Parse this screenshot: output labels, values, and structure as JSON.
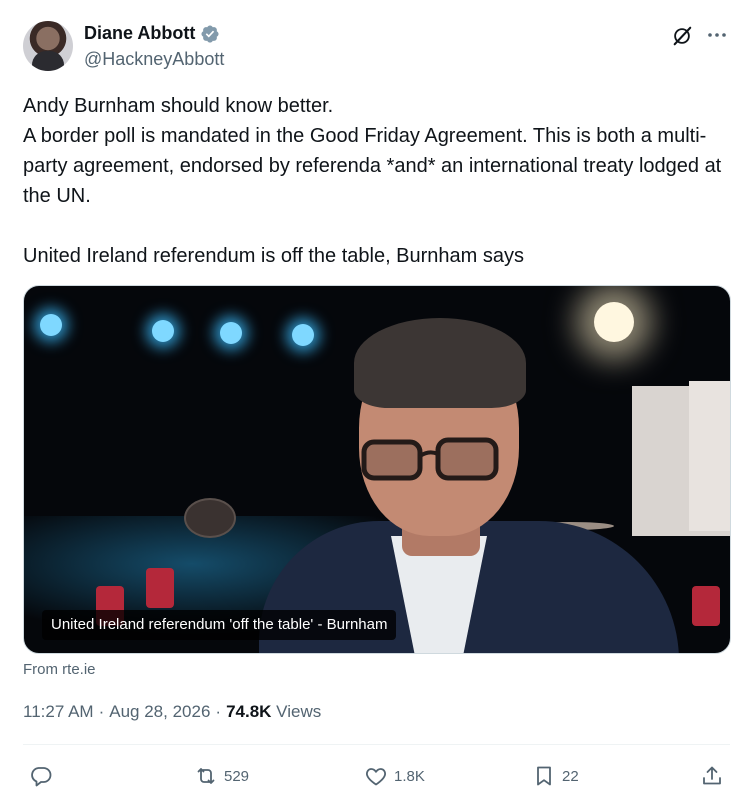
{
  "author": {
    "display_name": "Diane Abbott",
    "handle": "@HackneyAbbott",
    "verified": true
  },
  "tweet": {
    "paragraphs": [
      "Andy Burnham should know better.\nA border poll is mandated in the Good Friday Agreement. This is both a multi-party agreement, endorsed by referenda *and* an international treaty lodged at the UN.",
      "United Ireland referendum is off the table, Burnham says"
    ]
  },
  "media": {
    "caption": "United Ireland referendum 'off the table' - Burnham",
    "source": "From rte.ie"
  },
  "meta": {
    "time": "11:27 AM",
    "separator": "·",
    "date": "Aug 28, 2026",
    "views_count": "74.8K",
    "views_label": " Views"
  },
  "actions": {
    "reply_count": "",
    "repost_count": "529",
    "like_count": "1.8K",
    "bookmark_count": "22"
  },
  "icons": {
    "verified": "verified-badge-icon",
    "grok": "grok-icon",
    "more": "more-icon",
    "reply": "reply-icon",
    "repost": "repost-icon",
    "like": "heart-icon",
    "bookmark": "bookmark-icon",
    "share": "share-icon"
  },
  "colors": {
    "text_primary": "#0f1419",
    "text_secondary": "#536471",
    "verified": "#829aab",
    "divider": "#eff3f4"
  }
}
